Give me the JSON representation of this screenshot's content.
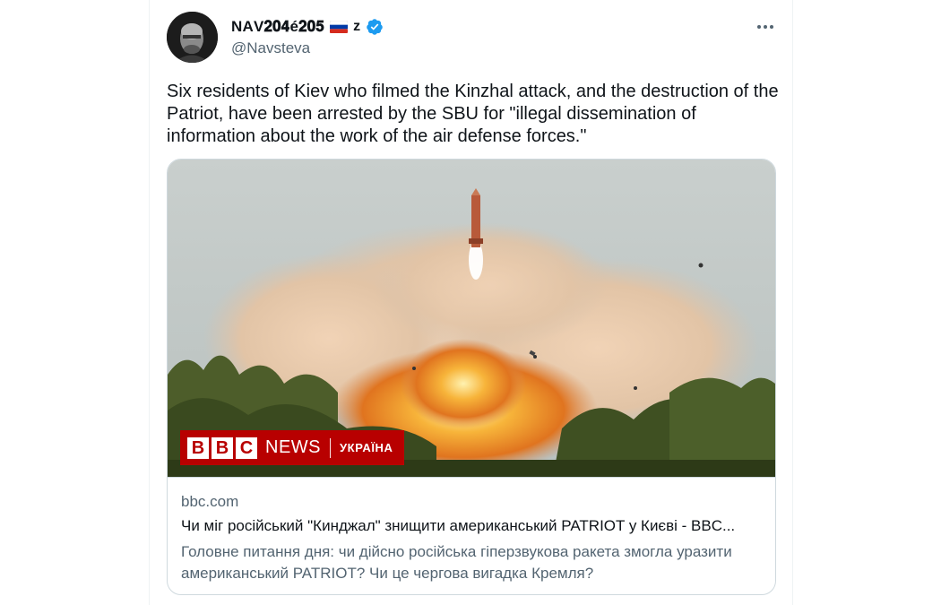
{
  "author": {
    "display_name": "ΝΑV𝟐𝟎𝟒é𝟐𝟎𝟓",
    "z_mark": "z",
    "handle": "@Navsteva",
    "verified": true,
    "flag_icon": "russia-flag-icon"
  },
  "tweet": {
    "text": "Six residents of Kiev who filmed the Kinzhal attack, and the destruction of the Patriot, have been arrested by the SBU for \"illegal dissemination of information about the work of the air defense forces.\""
  },
  "card": {
    "image_logo": {
      "blocks": [
        "B",
        "B",
        "C"
      ],
      "news": "NEWS",
      "edition": "УКРАЇНА"
    },
    "domain": "bbc.com",
    "title": "Чи міг російський \"Кинджал\" знищити американський PATRIOT у Києві - BBC...",
    "description": "Головне питання дня: чи дійсно російська гіперзвукова ракета змогла уразити американський PATRIOT? Чи це чергова вигадка Кремля?"
  },
  "colors": {
    "verified_blue": "#1d9bf0",
    "bbc_red": "#b80000",
    "secondary_text": "#536471"
  }
}
